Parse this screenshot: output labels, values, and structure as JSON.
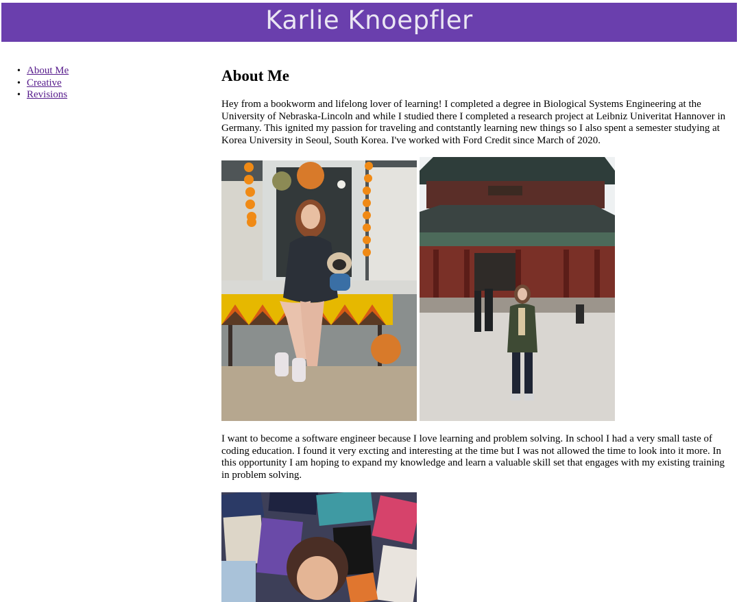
{
  "header": {
    "title": "Karlie Knoepfler"
  },
  "nav": {
    "items": [
      {
        "label": "About Me"
      },
      {
        "label": "Creative"
      },
      {
        "label": "Revisions"
      }
    ]
  },
  "main": {
    "heading": "About Me",
    "paragraph1": "Hey from a bookworm and lifelong lover of learning! I completed a degree in Biological Systems Engineering at the University of Nebraska-Lincoln and while I studied there I completed a research project at Leibniz Univeritat Hannover in Germany. This ignited my passion for traveling and contstantly learning new things so I also spent a semester studying at Korea University in Seoul, South Korea. I've worked with Ford Credit since March of 2020.",
    "paragraph2": "I want to become a software engineer because I love learning and problem solving. In school I had a very small taste of coding education. I found it very excting and interesting at the time but I was not allowed the time to look into it more. In this opportunity I am hoping to expand my knowledge and learn a valuable skill set that engages with my existing training in problem solving."
  },
  "photos": {
    "photo1": "woman-with-pug-autumn-photo",
    "photo2": "woman-at-korean-palace-photo",
    "photo3": "woman-among-books-photo"
  },
  "colors": {
    "header_bg": "#6a3fad",
    "header_text": "#eae6f3",
    "link": "#551a8b"
  }
}
